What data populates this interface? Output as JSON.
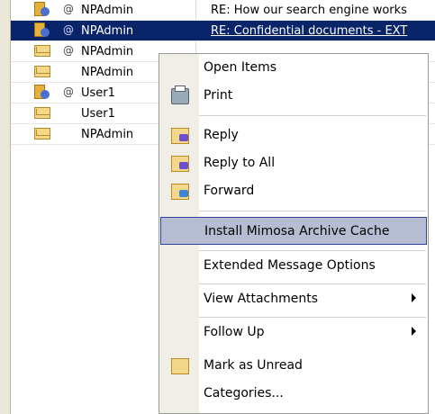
{
  "message_rows": [
    {
      "from": "NPAdmin",
      "subject": "RE: How our search engine works",
      "attachment": true,
      "icon": "document-person-icon",
      "selected": false
    },
    {
      "from": "NPAdmin",
      "subject": "RE: Confidential documents - EXT",
      "attachment": true,
      "icon": "document-person-icon",
      "selected": true
    },
    {
      "from": "NPAdmin",
      "subject": "",
      "attachment": true,
      "icon": "reply-envelope-icon",
      "selected": false
    },
    {
      "from": "NPAdmin",
      "subject": "",
      "attachment": false,
      "icon": "envelope-icon",
      "selected": false
    },
    {
      "from": "User1",
      "subject": "",
      "attachment": true,
      "icon": "document-person-icon",
      "selected": false
    },
    {
      "from": "User1",
      "subject": "",
      "attachment": false,
      "icon": "envelope-icon",
      "selected": false
    },
    {
      "from": "NPAdmin",
      "subject": "",
      "attachment": false,
      "icon": "envelope-icon",
      "selected": false
    }
  ],
  "context_menu": {
    "items": [
      {
        "label": "Open Items",
        "icon": "",
        "submenu": false
      },
      {
        "label": "Print",
        "icon": "printer-icon",
        "submenu": false
      },
      {
        "label": "Reply",
        "icon": "reply-icon",
        "submenu": false
      },
      {
        "label": "Reply to All",
        "icon": "reply-all-icon",
        "submenu": false
      },
      {
        "label": "Forward",
        "icon": "forward-icon",
        "submenu": false
      },
      {
        "label": "Install Mimosa Archive Cache",
        "icon": "",
        "submenu": false,
        "highlighted": true
      },
      {
        "label": "Extended Message Options",
        "icon": "",
        "submenu": false
      },
      {
        "label": "View Attachments",
        "icon": "",
        "submenu": true
      },
      {
        "label": "Follow Up",
        "icon": "",
        "submenu": true
      },
      {
        "label": "Mark as Unread",
        "icon": "envelope-icon",
        "submenu": false
      },
      {
        "label": "Categories...",
        "icon": "",
        "submenu": false
      }
    ]
  },
  "colors": {
    "selection": "#0a246a",
    "menu_highlight": "#b6bdd2",
    "menu_highlight_border": "#31469a"
  }
}
